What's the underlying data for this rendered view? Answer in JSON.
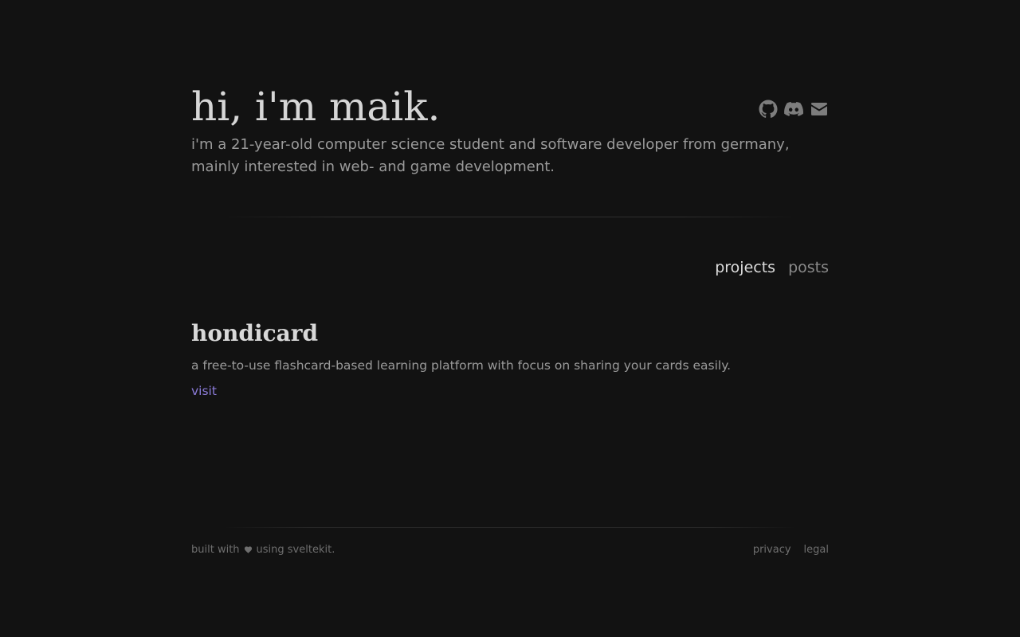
{
  "header": {
    "title": "hi, i'm maik.",
    "socials": [
      {
        "icon": "github-icon"
      },
      {
        "icon": "discord-icon"
      },
      {
        "icon": "mail-icon"
      }
    ]
  },
  "intro": "i'm a 21-year-old computer science student and software developer from germany, mainly interested in web- and game development.",
  "tabs": [
    {
      "label": "projects",
      "active": true
    },
    {
      "label": "posts",
      "active": false
    }
  ],
  "projects": [
    {
      "title": "hondicard",
      "description": "a free-to-use flashcard-based learning platform with focus on sharing your cards easily.",
      "link_label": "visit"
    }
  ],
  "footer": {
    "built_prefix": "built with",
    "built_icon": "heart-icon",
    "built_suffix": "using sveltekit.",
    "links": [
      "privacy",
      "legal"
    ]
  },
  "colors": {
    "background": "#121212",
    "accent_link": "#8b7bd8",
    "heading": "#d6d6d6",
    "body_text": "#9a9a9a"
  }
}
